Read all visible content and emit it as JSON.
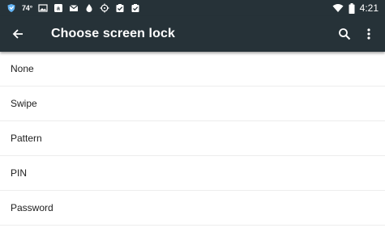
{
  "status_bar": {
    "temperature": "74°",
    "time": "4:21",
    "left_icons": [
      "shield-icon",
      "image-icon",
      "amazon-icon",
      "gmail-icon",
      "drop-icon",
      "crosshair-icon",
      "clipboard-check-icon",
      "clipboard-check-icon"
    ],
    "right_icons": [
      "wifi-icon",
      "battery-icon"
    ]
  },
  "app_bar": {
    "title": "Choose screen lock",
    "back_icon": "arrow-back-icon",
    "search_icon": "search-icon",
    "more_icon": "more-vert-icon"
  },
  "options": [
    {
      "label": "None"
    },
    {
      "label": "Swipe"
    },
    {
      "label": "Pattern"
    },
    {
      "label": "PIN"
    },
    {
      "label": "Password"
    }
  ],
  "colors": {
    "toolbar": "#263238",
    "text": "#212121",
    "divider": "#ededed"
  }
}
